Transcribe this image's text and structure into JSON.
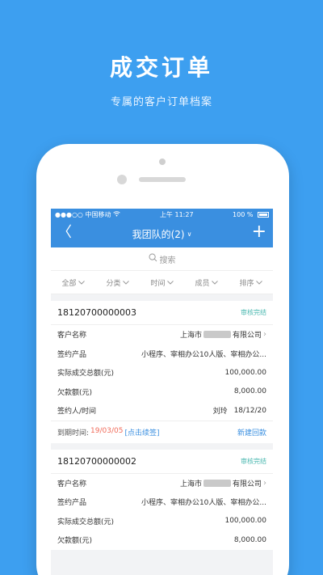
{
  "promo": {
    "title": "成交订单",
    "subtitle": "专属的客户订单档案"
  },
  "statusbar": {
    "carrier": "●●●○○ 中国移动",
    "wifi_icon": "wifi-icon",
    "time": "上午 11:27",
    "battery": "100 %"
  },
  "navbar": {
    "back": "〈",
    "title": "我团队的(2)",
    "title_chevron": "∨",
    "add": "+"
  },
  "search": {
    "icon": "search-icon",
    "placeholder": "搜索"
  },
  "filters": [
    {
      "label": "全部"
    },
    {
      "label": "分类"
    },
    {
      "label": "时间"
    },
    {
      "label": "成员"
    },
    {
      "label": "排序"
    }
  ],
  "orders": [
    {
      "order_no": "18120700000003",
      "status": "审核完结",
      "fields": {
        "customer_label": "客户名称",
        "customer_prefix": "上海市",
        "customer_suffix": "有限公司",
        "product_label": "签约产品",
        "product": "小程序、宰相办公10人版、宰相办公...",
        "total_label": "实际成交总额(元)",
        "total": "100,000.00",
        "owed_label": "欠款额(元)",
        "owed": "8,000.00",
        "signer_label": "签约人/时间",
        "signer": "刘玲",
        "sign_date": "18/12/20"
      },
      "footer": {
        "due_label": "到期时间:",
        "due_date": "19/03/05",
        "renew": "[点击续签]",
        "new_payment": "新建回款"
      }
    },
    {
      "order_no": "18120700000002",
      "status": "审核完结",
      "fields": {
        "customer_label": "客户名称",
        "customer_prefix": "上海市",
        "customer_suffix": "有限公司",
        "product_label": "签约产品",
        "product": "小程序、宰相办公10人版、宰相办公...",
        "total_label": "实际成交总额(元)",
        "total": "100,000.00",
        "owed_label": "欠款额(元)",
        "owed": "8,000.00"
      }
    }
  ],
  "colors": {
    "background": "#3d9ff0",
    "navbar": "#3a8fe0",
    "status": "#4bb8b0",
    "due": "#f06b5a"
  }
}
